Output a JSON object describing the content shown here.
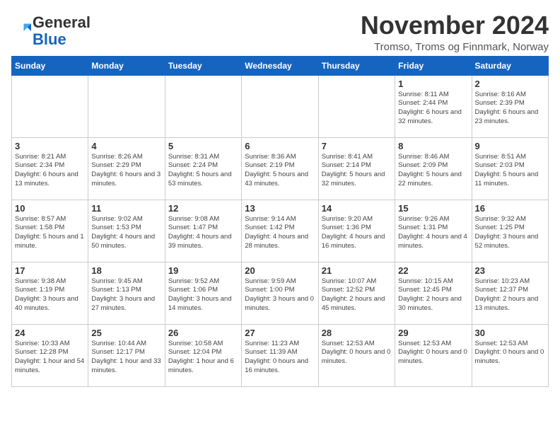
{
  "logo": {
    "general": "General",
    "blue": "Blue"
  },
  "header": {
    "month_year": "November 2024",
    "location": "Tromso, Troms og Finnmark, Norway"
  },
  "weekdays": [
    "Sunday",
    "Monday",
    "Tuesday",
    "Wednesday",
    "Thursday",
    "Friday",
    "Saturday"
  ],
  "weeks": [
    [
      {
        "day": "",
        "info": ""
      },
      {
        "day": "",
        "info": ""
      },
      {
        "day": "",
        "info": ""
      },
      {
        "day": "",
        "info": ""
      },
      {
        "day": "",
        "info": ""
      },
      {
        "day": "1",
        "info": "Sunrise: 8:11 AM\nSunset: 2:44 PM\nDaylight: 6 hours and 32 minutes."
      },
      {
        "day": "2",
        "info": "Sunrise: 8:16 AM\nSunset: 2:39 PM\nDaylight: 6 hours and 23 minutes."
      }
    ],
    [
      {
        "day": "3",
        "info": "Sunrise: 8:21 AM\nSunset: 2:34 PM\nDaylight: 6 hours and 13 minutes."
      },
      {
        "day": "4",
        "info": "Sunrise: 8:26 AM\nSunset: 2:29 PM\nDaylight: 6 hours and 3 minutes."
      },
      {
        "day": "5",
        "info": "Sunrise: 8:31 AM\nSunset: 2:24 PM\nDaylight: 5 hours and 53 minutes."
      },
      {
        "day": "6",
        "info": "Sunrise: 8:36 AM\nSunset: 2:19 PM\nDaylight: 5 hours and 43 minutes."
      },
      {
        "day": "7",
        "info": "Sunrise: 8:41 AM\nSunset: 2:14 PM\nDaylight: 5 hours and 32 minutes."
      },
      {
        "day": "8",
        "info": "Sunrise: 8:46 AM\nSunset: 2:09 PM\nDaylight: 5 hours and 22 minutes."
      },
      {
        "day": "9",
        "info": "Sunrise: 8:51 AM\nSunset: 2:03 PM\nDaylight: 5 hours and 11 minutes."
      }
    ],
    [
      {
        "day": "10",
        "info": "Sunrise: 8:57 AM\nSunset: 1:58 PM\nDaylight: 5 hours and 1 minute."
      },
      {
        "day": "11",
        "info": "Sunrise: 9:02 AM\nSunset: 1:53 PM\nDaylight: 4 hours and 50 minutes."
      },
      {
        "day": "12",
        "info": "Sunrise: 9:08 AM\nSunset: 1:47 PM\nDaylight: 4 hours and 39 minutes."
      },
      {
        "day": "13",
        "info": "Sunrise: 9:14 AM\nSunset: 1:42 PM\nDaylight: 4 hours and 28 minutes."
      },
      {
        "day": "14",
        "info": "Sunrise: 9:20 AM\nSunset: 1:36 PM\nDaylight: 4 hours and 16 minutes."
      },
      {
        "day": "15",
        "info": "Sunrise: 9:26 AM\nSunset: 1:31 PM\nDaylight: 4 hours and 4 minutes."
      },
      {
        "day": "16",
        "info": "Sunrise: 9:32 AM\nSunset: 1:25 PM\nDaylight: 3 hours and 52 minutes."
      }
    ],
    [
      {
        "day": "17",
        "info": "Sunrise: 9:38 AM\nSunset: 1:19 PM\nDaylight: 3 hours and 40 minutes."
      },
      {
        "day": "18",
        "info": "Sunrise: 9:45 AM\nSunset: 1:13 PM\nDaylight: 3 hours and 27 minutes."
      },
      {
        "day": "19",
        "info": "Sunrise: 9:52 AM\nSunset: 1:06 PM\nDaylight: 3 hours and 14 minutes."
      },
      {
        "day": "20",
        "info": "Sunrise: 9:59 AM\nSunset: 1:00 PM\nDaylight: 3 hours and 0 minutes."
      },
      {
        "day": "21",
        "info": "Sunrise: 10:07 AM\nSunset: 12:52 PM\nDaylight: 2 hours and 45 minutes."
      },
      {
        "day": "22",
        "info": "Sunrise: 10:15 AM\nSunset: 12:45 PM\nDaylight: 2 hours and 30 minutes."
      },
      {
        "day": "23",
        "info": "Sunrise: 10:23 AM\nSunset: 12:37 PM\nDaylight: 2 hours and 13 minutes."
      }
    ],
    [
      {
        "day": "24",
        "info": "Sunrise: 10:33 AM\nSunset: 12:28 PM\nDaylight: 1 hour and 54 minutes."
      },
      {
        "day": "25",
        "info": "Sunrise: 10:44 AM\nSunset: 12:17 PM\nDaylight: 1 hour and 33 minutes."
      },
      {
        "day": "26",
        "info": "Sunrise: 10:58 AM\nSunset: 12:04 PM\nDaylight: 1 hour and 6 minutes."
      },
      {
        "day": "27",
        "info": "Sunrise: 11:23 AM\nSunset: 11:39 AM\nDaylight: 0 hours and 16 minutes."
      },
      {
        "day": "28",
        "info": "Sunset: 12:53 AM\nDaylight: 0 hours and 0 minutes."
      },
      {
        "day": "29",
        "info": "Sunset: 12:53 AM\nDaylight: 0 hours and 0 minutes."
      },
      {
        "day": "30",
        "info": "Sunset: 12:53 AM\nDaylight: 0 hours and 0 minutes."
      }
    ]
  ]
}
